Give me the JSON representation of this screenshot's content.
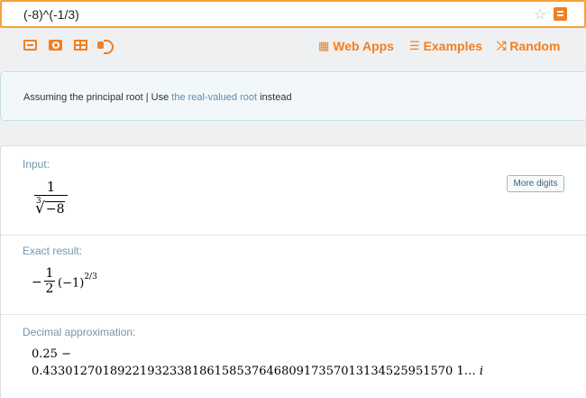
{
  "search": {
    "query": "(-8)^(-1/3)"
  },
  "toolbar": {
    "icons": [
      "keyboard-icon",
      "camera-icon",
      "table-icon",
      "speaker-icon"
    ],
    "links": [
      {
        "label": "Web Apps",
        "icon": "grid-icon"
      },
      {
        "label": "Examples",
        "icon": "list-icon"
      },
      {
        "label": "Random",
        "icon": "shuffle-icon"
      }
    ]
  },
  "assumption": {
    "prefix": "Assuming the principal root | Use ",
    "link": "the real-valued root",
    "suffix": " instead"
  },
  "pods": {
    "input": {
      "title": "Input:",
      "numerator": "1",
      "root_index": "3",
      "radicand": "−8"
    },
    "exact": {
      "title": "Exact result:",
      "sign": "−",
      "numerator": "1",
      "denominator": "2",
      "base": "(−1)",
      "exponent": "2/3"
    },
    "decimal": {
      "title": "Decimal approximation:",
      "more_digits_label": "More digits",
      "line1": "0.25 −",
      "line2": "0.4330127018922193233818615853764680917357013134525951570 1… ",
      "imag_unit": "i"
    }
  },
  "colors": {
    "accent": "#f27f21",
    "search_border": "#f6a236",
    "link": "#5a8fb7",
    "pod_title": "#7296ae"
  }
}
